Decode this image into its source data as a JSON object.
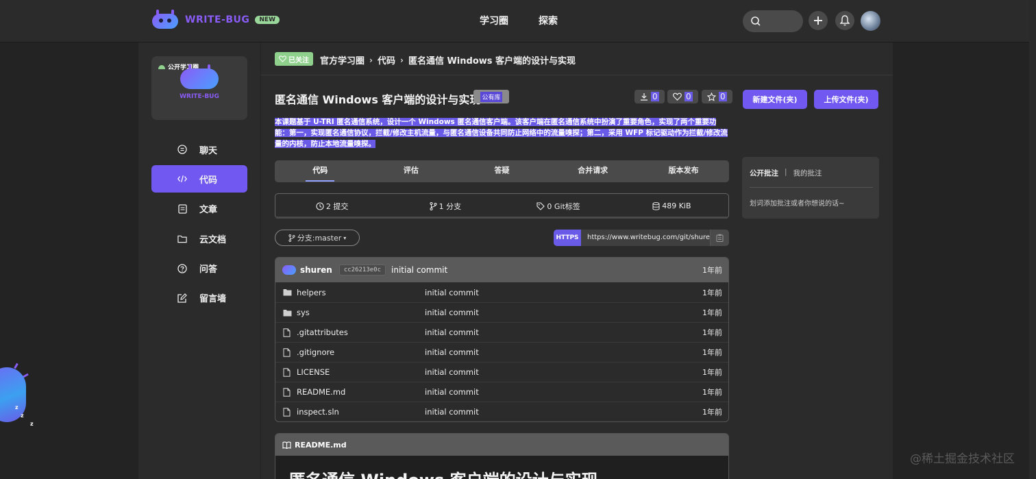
{
  "brand": {
    "name": "WRITE-BUG",
    "badge": "NEW"
  },
  "topnav": {
    "items": [
      "学习圈",
      "探索"
    ]
  },
  "header_icons": [
    "search-icon",
    "plus-icon",
    "bell-icon",
    "avatar"
  ],
  "sidebar": {
    "circle": {
      "tag": "公开学习圈",
      "name": "WRITE-BUG"
    },
    "items": [
      {
        "label": "聊天",
        "icon": "chat-icon"
      },
      {
        "label": "代码",
        "icon": "code-icon",
        "active": true
      },
      {
        "label": "文章",
        "icon": "article-icon"
      },
      {
        "label": "云文档",
        "icon": "folder-icon"
      },
      {
        "label": "问答",
        "icon": "question-icon"
      },
      {
        "label": "留言墙",
        "icon": "edit-icon"
      }
    ]
  },
  "breadcrumb": {
    "followed": "已关注",
    "items": [
      "官方学习圈",
      "代码",
      "匿名通信 Windows 客户端的设计与实现"
    ]
  },
  "repo": {
    "title": "匿名通信 Windows 客户端的设计与实现",
    "visibility": "公有库",
    "downloads": "0",
    "likes": "0",
    "stars": "0",
    "new_file_label": "新建文件(夹)",
    "upload_label": "上传文件(夹)",
    "description": "本课题基于 U-TRI 匿名通信系统，设计一个 Windows 匿名通信客户端。该客户端在匿名通信系统中扮演了重要角色，实现了两个重要功能：第一，实现匿名通信协议，拦截/修改主机流量，与匿名通信设备共同防止网络中的流量嗅探；第二，采用 WFP 标记驱动作为拦截/修改流量的内核，防止本地流量嗅探。"
  },
  "tabs": [
    "代码",
    "评估",
    "答疑",
    "合并请求",
    "版本发布"
  ],
  "stats": {
    "commits": "2 提交",
    "branches": "1 分支",
    "tags": "0 Git标签",
    "size": "489 KiB"
  },
  "branch": {
    "label": "分支:master"
  },
  "clone": {
    "protocol": "HTTPS",
    "url": "https://www.writebug.com/git/shuren"
  },
  "latest_commit": {
    "author": "shuren",
    "hash": "cc26213e0c",
    "message": "initial commit",
    "time": "1年前"
  },
  "files": [
    {
      "name": "helpers",
      "type": "folder",
      "message": "initial commit",
      "time": "1年前"
    },
    {
      "name": "sys",
      "type": "folder",
      "message": "initial commit",
      "time": "1年前"
    },
    {
      "name": ".gitattributes",
      "type": "file",
      "message": "initial commit",
      "time": "1年前"
    },
    {
      "name": ".gitignore",
      "type": "file",
      "message": "initial commit",
      "time": "1年前"
    },
    {
      "name": "LICENSE",
      "type": "file",
      "message": "initial commit",
      "time": "1年前"
    },
    {
      "name": "README.md",
      "type": "file",
      "message": "initial commit",
      "time": "1年前"
    },
    {
      "name": "inspect.sln",
      "type": "file",
      "message": "initial commit",
      "time": "1年前"
    }
  ],
  "readme": {
    "filename": "README.md",
    "heading": "匿名通信 Windows 客户端的设计与实现"
  },
  "annotations": {
    "tab_public": "公开批注",
    "separator": "|",
    "tab_mine": "我的批注",
    "hint": "划词添加批注或者你想说的话~"
  },
  "watermark": "@稀土掘金技术社区",
  "colors": {
    "accent": "#7158f0",
    "followed": "#8fd18c",
    "background": "#232323",
    "panel": "#2b2b2b"
  }
}
